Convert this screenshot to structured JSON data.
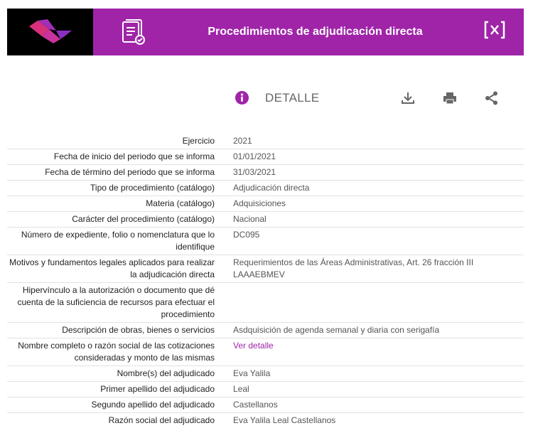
{
  "header": {
    "title": "Procedimientos de adjudicación directa",
    "brand_color": "#9f24a8",
    "icons": {
      "logo": "brand-logo",
      "document": "document-check-icon",
      "close": "close-icon"
    }
  },
  "toolbar": {
    "section_label": "DETALLE",
    "icons": [
      "info-icon",
      "download-icon",
      "print-icon",
      "share-icon"
    ]
  },
  "details": [
    {
      "label": "Ejercicio",
      "value": "2021"
    },
    {
      "label": "Fecha de inicio del periodo que se informa",
      "value": "01/01/2021"
    },
    {
      "label": "Fecha de término del periodo que se informa",
      "value": "31/03/2021"
    },
    {
      "label": "Tipo de procedimiento (catálogo)",
      "value": "Adjudicación directa"
    },
    {
      "label": "Materia (catálogo)",
      "value": "Adquisiciones"
    },
    {
      "label": "Carácter del procedimiento (catálogo)",
      "value": "Nacional"
    },
    {
      "label": "Número de expediente, folio o nomenclatura que lo identifique",
      "value": "DC095"
    },
    {
      "label": "Motivos y fundamentos legales aplicados para realizar la adjudicación directa",
      "value": "Requerimientos de las Áreas Administrativas, Art. 26 fracción III LAAAEBMEV"
    },
    {
      "label": "Hipervínculo a la autorización o documento que dé cuenta de la suficiencia de recursos para efectuar el procedimiento",
      "value": ""
    },
    {
      "label": "Descripción de obras, bienes o servicios",
      "value": "Asdquisición de agenda semanal y diaria con serigafía"
    },
    {
      "label": "Nombre completo o razón social de las cotizaciones consideradas y monto de las mismas",
      "value": "Ver detalle",
      "link": true
    },
    {
      "label": "Nombre(s) del adjudicado",
      "value": "Eva Yalila"
    },
    {
      "label": "Primer apellido del adjudicado",
      "value": "Leal"
    },
    {
      "label": "Segundo apellido del adjudicado",
      "value": "Castellanos"
    },
    {
      "label": "Razón social del adjudicado",
      "value": "Eva Yalila Leal Castellanos"
    }
  ]
}
